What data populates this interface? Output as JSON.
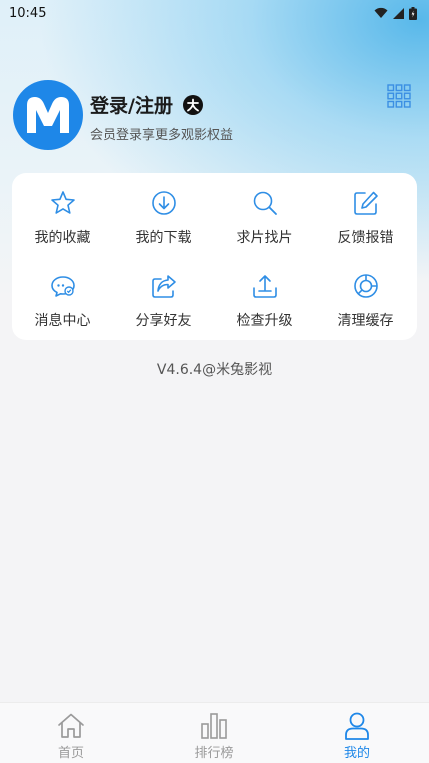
{
  "status_bar": {
    "time": "10:45"
  },
  "profile": {
    "title": "登录/注册",
    "subtitle": "会员登录享更多观影权益",
    "badge_text": "大"
  },
  "features": [
    {
      "label": "我的收藏",
      "icon": "star-icon"
    },
    {
      "label": "我的下载",
      "icon": "download-icon"
    },
    {
      "label": "求片找片",
      "icon": "search-icon"
    },
    {
      "label": "反馈报错",
      "icon": "edit-icon"
    },
    {
      "label": "消息中心",
      "icon": "message-icon"
    },
    {
      "label": "分享好友",
      "icon": "share-icon"
    },
    {
      "label": "检查升级",
      "icon": "upload-icon"
    },
    {
      "label": "清理缓存",
      "icon": "pie-chart-icon"
    }
  ],
  "version": "V4.6.4@米兔影视",
  "bottom_nav": [
    {
      "label": "首页",
      "icon": "home-icon",
      "active": false
    },
    {
      "label": "排行榜",
      "icon": "bar-chart-icon",
      "active": false
    },
    {
      "label": "我的",
      "icon": "user-icon",
      "active": true
    }
  ],
  "colors": {
    "accent": "#1e87e8",
    "inactive": "#9a9a9a"
  }
}
